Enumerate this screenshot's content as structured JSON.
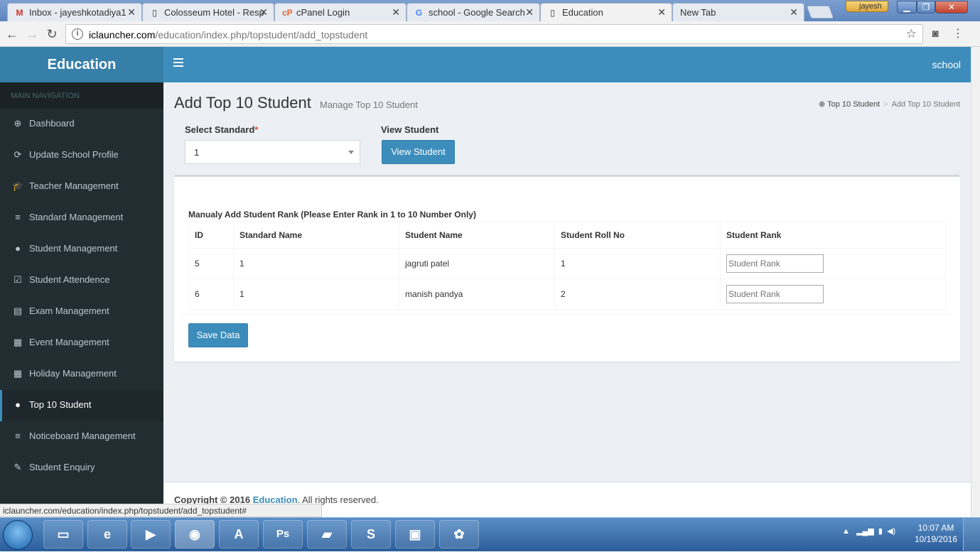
{
  "browser": {
    "tabs": [
      {
        "title": "Inbox - jayeshkotadiya1",
        "icon": "gmail-icon"
      },
      {
        "title": "Colosseum Hotel - Resp",
        "icon": "page-icon"
      },
      {
        "title": "cPanel Login",
        "icon": "cpanel-icon"
      },
      {
        "title": "school - Google Search",
        "icon": "google-icon"
      },
      {
        "title": "Education",
        "icon": "page-icon"
      },
      {
        "title": "New Tab",
        "icon": ""
      }
    ],
    "user": "jayesh",
    "url_host": "iclauncher.com",
    "url_path": "/education/index.php/topstudent/add_topstudent",
    "status_url": "iclauncher.com/education/index.php/topstudent/add_topstudent#"
  },
  "app": {
    "logo": "Education",
    "user_label": "school"
  },
  "sidebar": {
    "header": "MAIN NAVIGATION",
    "items": [
      {
        "label": "Dashboard",
        "icon": "dashboard-icon",
        "glyph": "⊕"
      },
      {
        "label": "Update School Profile",
        "icon": "refresh-icon",
        "glyph": "⟳"
      },
      {
        "label": "Teacher Management",
        "icon": "graduation-cap-icon",
        "glyph": "🎓"
      },
      {
        "label": "Standard Management",
        "icon": "list-icon",
        "glyph": "≡"
      },
      {
        "label": "Student Management",
        "icon": "user-icon",
        "glyph": "●"
      },
      {
        "label": "Student Attendence",
        "icon": "calendar-check-icon",
        "glyph": "☑"
      },
      {
        "label": "Exam Management",
        "icon": "briefcase-icon",
        "glyph": "▤"
      },
      {
        "label": "Event Management",
        "icon": "calendar-icon",
        "glyph": "▦"
      },
      {
        "label": "Holiday Management",
        "icon": "calendar-icon",
        "glyph": "▦"
      },
      {
        "label": "Top 10 Student",
        "icon": "user-icon",
        "glyph": "●"
      },
      {
        "label": "Noticeboard Management",
        "icon": "list-icon",
        "glyph": "≡"
      },
      {
        "label": "Student Enquiry",
        "icon": "edit-icon",
        "glyph": "✎"
      }
    ],
    "active_index": 9
  },
  "page": {
    "title": "Add Top 10 Student",
    "subtitle": "Manage Top 10 Student",
    "breadcrumb": [
      "Top 10 Student",
      "Add Top 10 Student"
    ],
    "select_label": "Select Standard",
    "select_required": "*",
    "select_value": "1",
    "view_label": "View Student",
    "view_button": "View Student",
    "table_caption": "Manualy Add Student Rank (Please Enter Rank in 1 to 10 Number Only)",
    "columns": [
      "ID",
      "Standard Name",
      "Student Name",
      "Student Roll No",
      "Student Rank"
    ],
    "rows": [
      {
        "id": "5",
        "standard": "1",
        "name": "jagruti patel",
        "roll": "1"
      },
      {
        "id": "6",
        "standard": "1",
        "name": "manish pandya",
        "roll": "2"
      }
    ],
    "rank_placeholder": "Student Rank",
    "save_button": "Save Data"
  },
  "footer": {
    "prefix": "Copyright © 2016 ",
    "link": "Education",
    "suffix": ". All rights reserved."
  },
  "taskbar": {
    "apps": [
      {
        "name": "file-explorer-icon",
        "glyph": "▭"
      },
      {
        "name": "internet-explorer-icon",
        "glyph": "e"
      },
      {
        "name": "media-player-icon",
        "glyph": "▶"
      },
      {
        "name": "chrome-icon",
        "glyph": "◉"
      },
      {
        "name": "android-studio-icon",
        "glyph": "A"
      },
      {
        "name": "photoshop-icon",
        "glyph": "Ps"
      },
      {
        "name": "sticky-notes-icon",
        "glyph": "▰"
      },
      {
        "name": "skype-icon",
        "glyph": "S"
      },
      {
        "name": "window-app-icon",
        "glyph": "▣"
      },
      {
        "name": "paint-icon",
        "glyph": "✿"
      }
    ],
    "time": "10:07 AM",
    "date": "10/19/2016"
  }
}
